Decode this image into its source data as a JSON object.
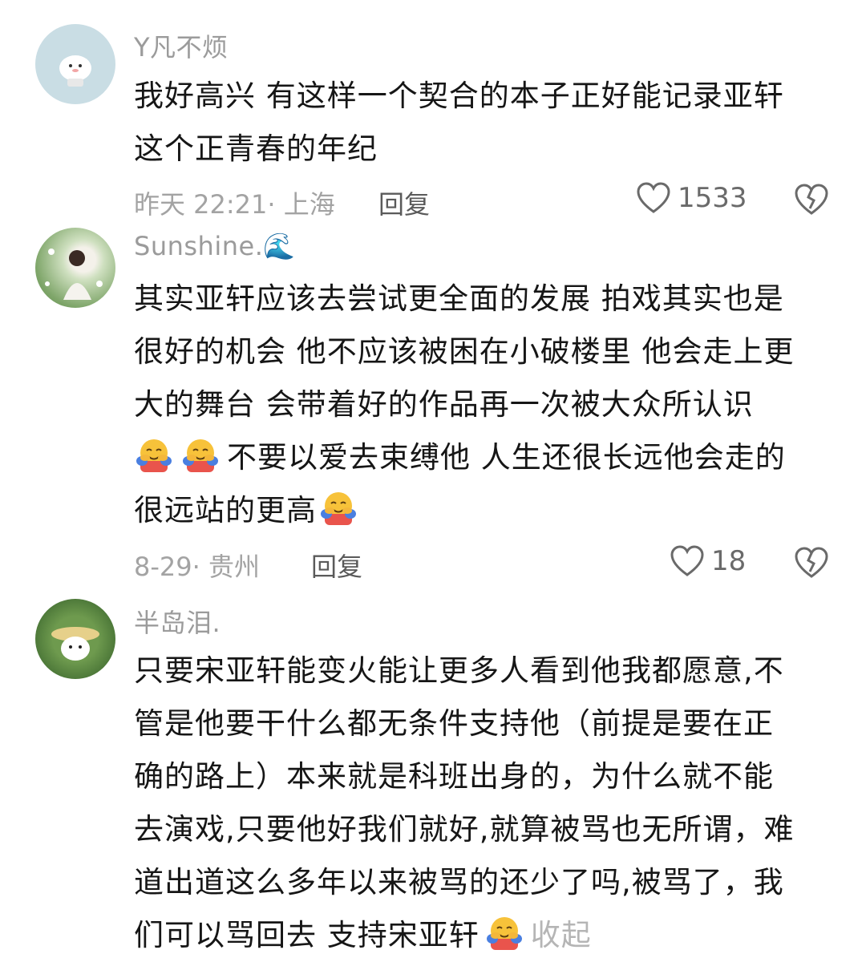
{
  "comments": [
    {
      "username": "Y凡不烦",
      "lines": [
        "我好高兴 有这样一个契合的本子正好能记录亚轩",
        "这个正青春的年纪"
      ],
      "meta": "昨天 22:21· 上海",
      "reply_label": "回复",
      "likes": "1533"
    },
    {
      "username": "Sunshine.🌊",
      "lines": [
        "其实亚轩应该去尝试更全面的发展 拍戏其实也是",
        "很好的机会 他不应该被困在小破楼里 他会走上更",
        "大的舞台 会带着好的作品再一次被大众所认识"
      ],
      "line4_text": "不要以爱去束缚他 人生还很长远他会走的",
      "line5_text": "很远站的更高",
      "meta": "8-29· 贵州",
      "reply_label": "回复",
      "likes": "18"
    },
    {
      "username": "半岛泪.",
      "lines": [
        "只要宋亚轩能变火能让更多人看到他我都愿意,不",
        "管是他要干什么都无条件支持他（前提是要在正",
        "确的路上）本来就是科班出身的，为什么就不能",
        "去演戏,只要他好我们就好,就算被骂也无所谓，难",
        "道出道这么多年以来被骂的还少了吗,被骂了，我"
      ],
      "last_line_text": "们可以骂回去 支持宋亚轩",
      "collapse_label": "收起"
    }
  ],
  "icons": {
    "like": "heart-outline-icon",
    "dislike": "broken-heart-icon",
    "emoji": "hugging-face-emoji"
  }
}
